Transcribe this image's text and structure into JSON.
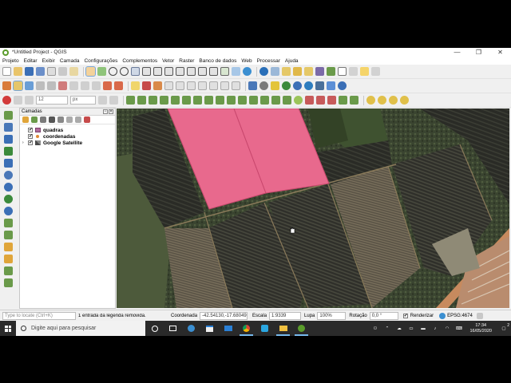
{
  "window": {
    "title": "*Untitled Project - QGIS",
    "controls": [
      "—",
      "❐",
      "✕"
    ]
  },
  "menu": [
    "Projeto",
    "Editar",
    "Exibir",
    "Camada",
    "Configurações",
    "Complementos",
    "Vetor",
    "Raster",
    "Banco de dados",
    "Web",
    "Processar",
    "Ajuda"
  ],
  "toolbar3": {
    "font_size": "12",
    "unit": "px"
  },
  "layers_panel": {
    "title": "Camadas",
    "layers": [
      {
        "name": "quadras",
        "checked": true,
        "symbol_color": "#b06b9a",
        "symbol": "polygon"
      },
      {
        "name": "coordenadas",
        "checked": true,
        "symbol_color": "#e08a35",
        "symbol": "point"
      },
      {
        "name": "Google Satellite",
        "checked": true,
        "symbol_color": "#4b4b4b",
        "symbol": "raster"
      }
    ]
  },
  "map": {
    "polygon_fill": "#e8698d",
    "polygon_stroke": "#c8476d"
  },
  "status": {
    "locate_placeholder": "Type to locate (Ctrl+K)",
    "message": "1 entrada da legenda removida.",
    "coord_label": "Coordenada",
    "coord_value": "-42.54130,-17.68049",
    "scale_label": "Escala",
    "scale_value": "1:9339",
    "zoom_label": "Lupa",
    "zoom_value": "100%",
    "rotation_label": "Rotação",
    "rotation_value": "0,0 °",
    "render_label": "Renderizar",
    "render_checked": true,
    "crs": "EPSG:4674"
  },
  "taskbar": {
    "search_placeholder": "Digite aqui para pesquisar",
    "time": "17:34",
    "date": "16/05/2020",
    "notification_count": "2"
  },
  "colors": {
    "accent": "#76b9ed",
    "qgis_green": "#5a9c2b"
  }
}
